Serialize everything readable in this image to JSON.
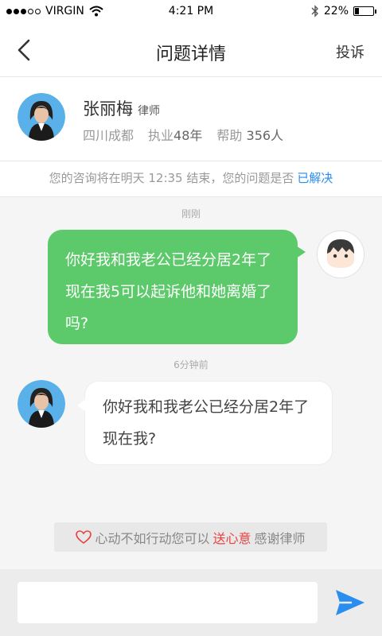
{
  "status_bar": {
    "carrier": "VIRGIN",
    "time": "4:21 PM",
    "battery": "22%",
    "battery_level": 0.22
  },
  "nav": {
    "title": "问题详情",
    "report": "投诉"
  },
  "lawyer": {
    "name": "张丽梅",
    "role": "律师",
    "location": "四川成都",
    "practice_label": "执业",
    "practice_years": "48年",
    "helped_label": "帮助",
    "helped_count": "356人"
  },
  "notice": {
    "text": "您的咨询将在明天 12:35 结束，您的问题是否",
    "link": "已解决"
  },
  "chat": {
    "messages": [
      {
        "time": "刚刚",
        "sender": "user",
        "text": "你好我和我老公已经分居2年了现在我5可以起诉他和她离婚了吗?"
      },
      {
        "time": "6分钟前",
        "sender": "lawyer",
        "text": "你好我和我老公已经分居2年了现在我?"
      }
    ]
  },
  "thanks": {
    "prefix": "心动不如行动您可以",
    "highlight": "送心意",
    "suffix": "感谢律师"
  },
  "composer": {
    "placeholder": ""
  },
  "colors": {
    "user_bubble": "#5cca6a",
    "link": "#2a8df0",
    "accent_red": "#e94141"
  }
}
